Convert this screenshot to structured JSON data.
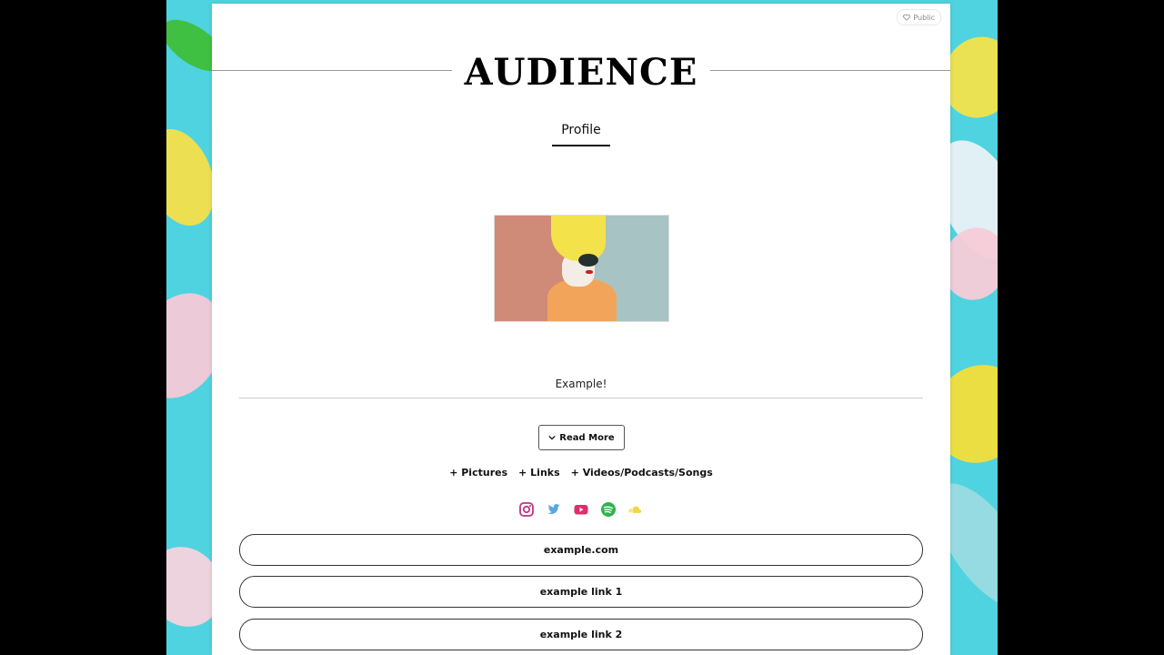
{
  "badge": {
    "label": "Public"
  },
  "header": {
    "title": "AUDIENCE"
  },
  "tabs": [
    {
      "label": "Profile"
    }
  ],
  "bio": {
    "text": "Example!"
  },
  "read_more": {
    "label": "Read More"
  },
  "sections": [
    {
      "label": "+ Pictures"
    },
    {
      "label": "+ Links"
    },
    {
      "label": "+ Videos/Podcasts/Songs"
    }
  ],
  "social_icons": [
    "instagram-icon",
    "twitter-icon",
    "youtube-icon",
    "spotify-icon",
    "soundcloud-icon"
  ],
  "colors": {
    "instagram": "#c13584",
    "twitter": "#5aa7e0",
    "youtube": "#e12d6a",
    "spotify": "#2fb34f",
    "soundcloud": "#f2d64a",
    "background": "#4fd3e0"
  },
  "links": [
    {
      "label": "example.com"
    },
    {
      "label": "example link 1"
    },
    {
      "label": "example link 2"
    }
  ]
}
